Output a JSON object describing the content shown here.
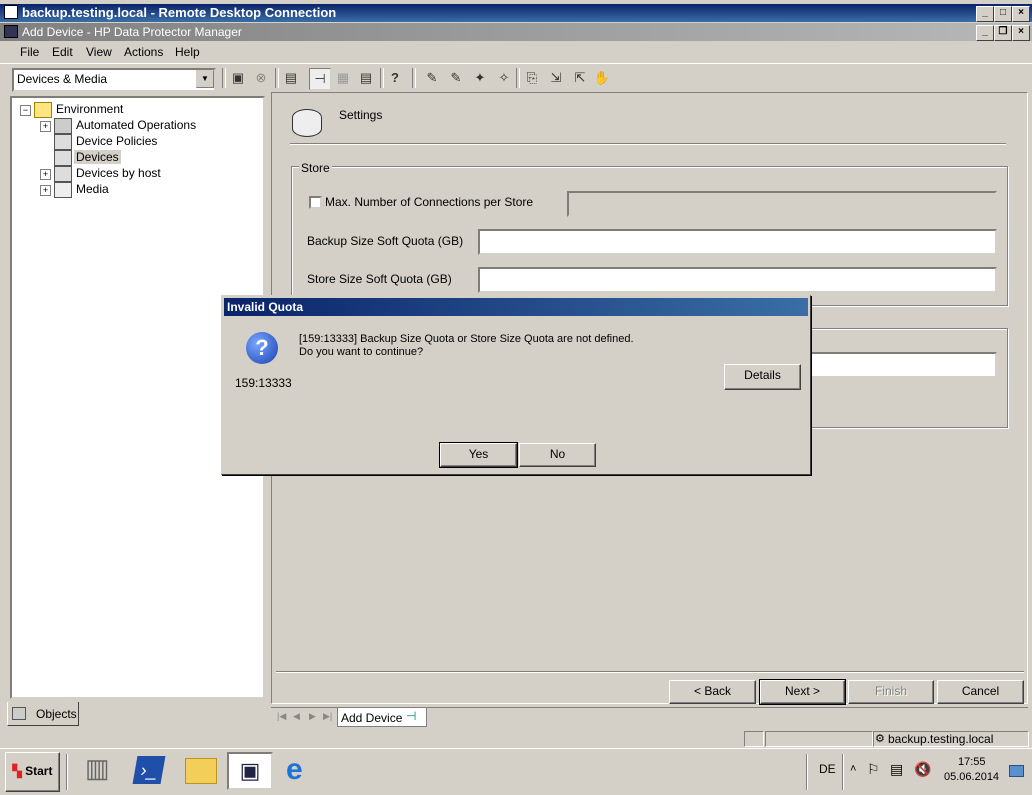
{
  "rdp": {
    "title": "backup.testing.local - Remote Desktop Connection"
  },
  "app": {
    "title": "Add Device - HP Data Protector Manager"
  },
  "menu": [
    "File",
    "Edit",
    "View",
    "Actions",
    "Help"
  ],
  "toolbar": {
    "context": "Devices & Media"
  },
  "tree": {
    "root": "Environment",
    "items": [
      "Automated Operations",
      "Device Policies",
      "Devices",
      "Devices by host",
      "Media"
    ]
  },
  "left_tab": {
    "label": "Objects"
  },
  "settings": {
    "title": "Settings"
  },
  "store": {
    "group_label": "Store",
    "max_conn_label": "Max. Number of Connections per Store",
    "max_conn_checked": false,
    "backup_quota_label": "Backup Size Soft Quota (GB)",
    "store_quota_label": "Store Size Soft Quota (GB)"
  },
  "wizard": {
    "back": "< Back",
    "next": "Next >",
    "finish": "Finish",
    "cancel": "Cancel"
  },
  "bottom_tab": {
    "label": "Add Device"
  },
  "dialog": {
    "title": "Invalid Quota",
    "message_line1": "[159:13333] Backup Size Quota or Store Size Quota are not defined.",
    "message_line2": "Do you want to continue?",
    "code": "159:13333",
    "details": "Details",
    "yes": "Yes",
    "no": "No"
  },
  "status": {
    "host": "backup.testing.local"
  },
  "taskbar": {
    "start": "Start",
    "lang": "DE",
    "time": "17:55",
    "date": "05.06.2014"
  }
}
